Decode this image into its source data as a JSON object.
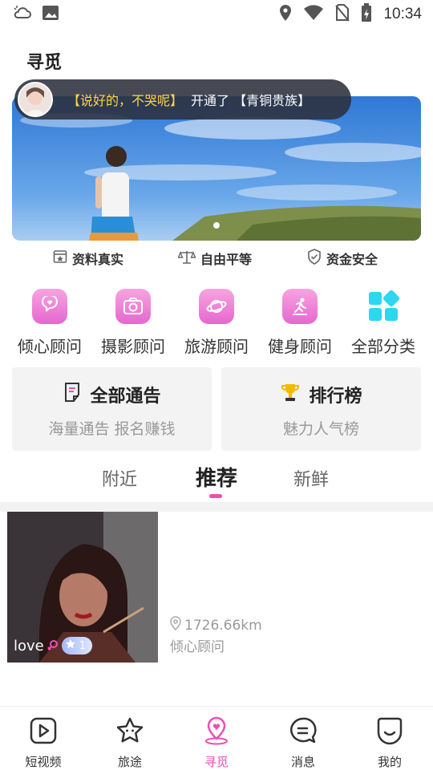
{
  "status_bar": {
    "time": "10:34",
    "icons": [
      "cloud-icon",
      "image-icon",
      "location-icon",
      "wifi-icon",
      "no-sim-icon",
      "battery-icon"
    ]
  },
  "page": {
    "title": "寻觅"
  },
  "notice": {
    "user": "【说好的，不哭呢】",
    "message": "开通了 【青铜贵族】"
  },
  "trust_badges": [
    {
      "label": "资料真实",
      "icon": "profile-card-icon"
    },
    {
      "label": "自由平等",
      "icon": "balance-scale-icon"
    },
    {
      "label": "资金安全",
      "icon": "shield-icon"
    }
  ],
  "categories": [
    {
      "label": "倾心顾问",
      "icon": "heart-chat-icon"
    },
    {
      "label": "摄影顾问",
      "icon": "camera-icon"
    },
    {
      "label": "旅游顾问",
      "icon": "planet-icon"
    },
    {
      "label": "健身顾问",
      "icon": "fitness-icon"
    },
    {
      "label": "全部分类",
      "icon": "grid-icon"
    }
  ],
  "cards": {
    "notices": {
      "title": "全部通告",
      "subtitle": "海量通告 报名赚钱",
      "icon": "notice-icon"
    },
    "ranking": {
      "title": "排行榜",
      "subtitle": "魅力人气榜",
      "icon": "trophy-icon"
    }
  },
  "tabs": [
    {
      "label": "附近",
      "active": false
    },
    {
      "label": "推荐",
      "active": true
    },
    {
      "label": "新鲜",
      "active": false
    }
  ],
  "list": [
    {
      "name": "love",
      "level": "1",
      "distance": "1726.66km",
      "category": "倾心顾问"
    }
  ],
  "bottom_nav": [
    {
      "label": "短视频",
      "icon": "video-icon",
      "active": false
    },
    {
      "label": "旅途",
      "icon": "star-icon",
      "active": false
    },
    {
      "label": "寻觅",
      "icon": "location-pin-icon",
      "active": true
    },
    {
      "label": "消息",
      "icon": "message-icon",
      "active": false
    },
    {
      "label": "我的",
      "icon": "smile-icon",
      "active": false
    }
  ],
  "colors": {
    "accent": "#ee4fb3",
    "category_gradient_top": "#f7a4e0",
    "category_gradient_bottom": "#e667cf",
    "grid_icon": "#2fd6f0",
    "notice_user": "#ffd54a"
  }
}
